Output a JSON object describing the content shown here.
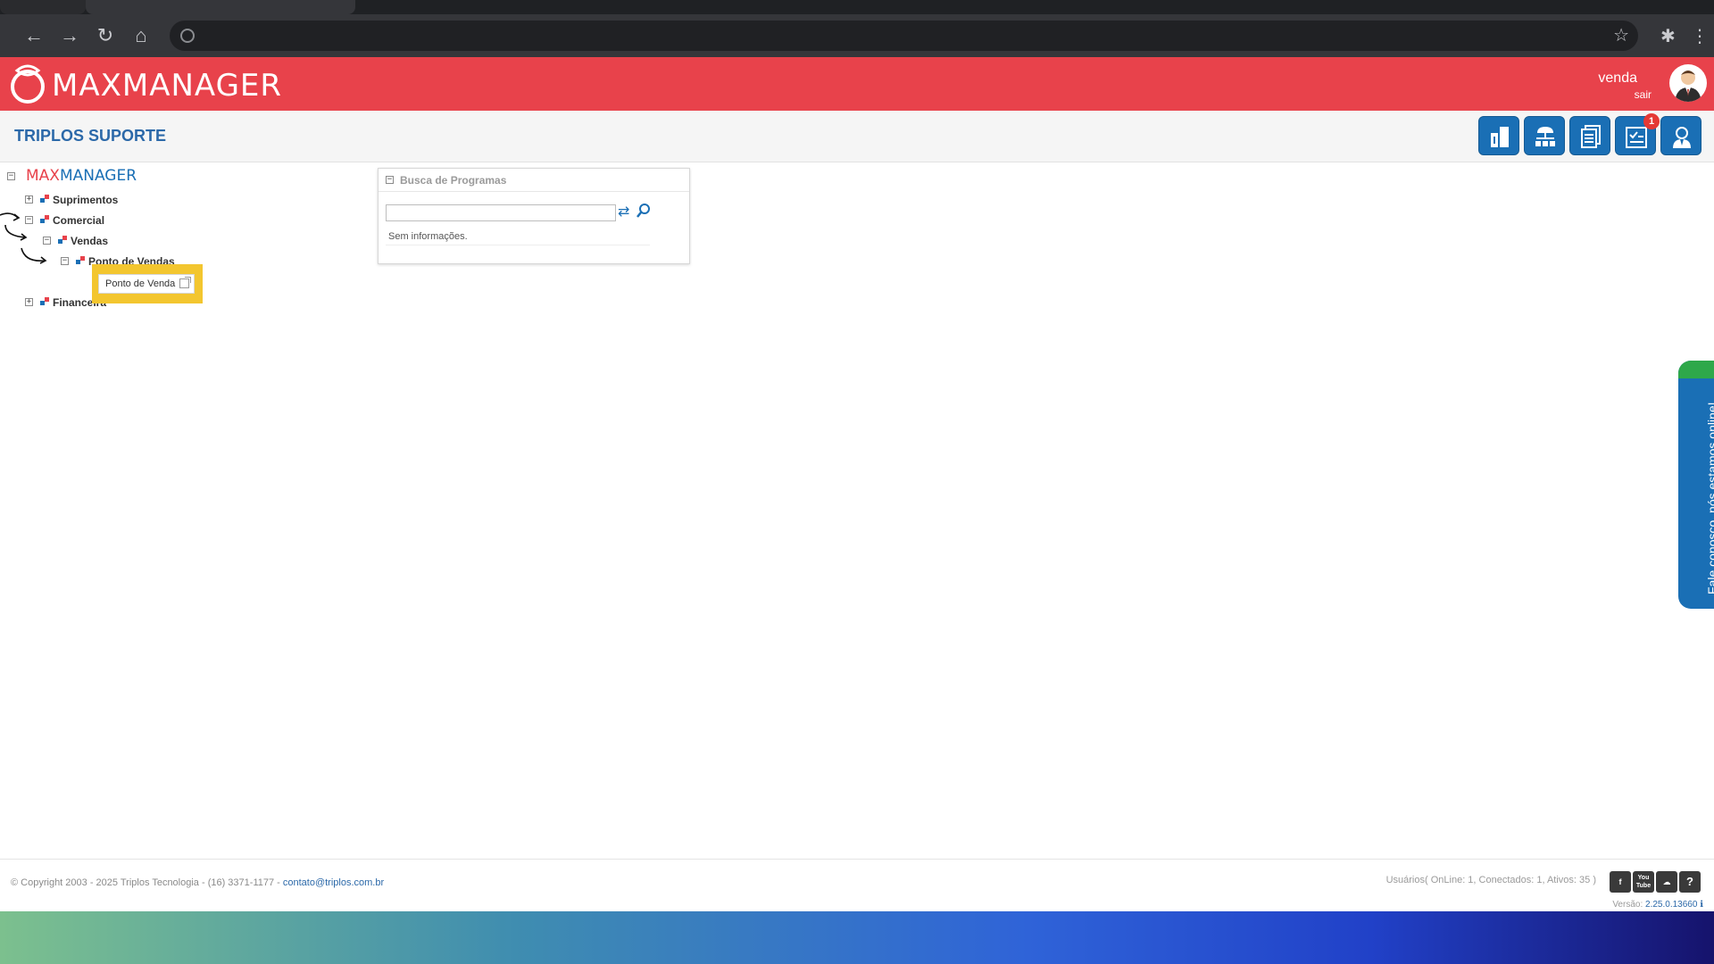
{
  "app": {
    "logo_text": "MAXMANAGER",
    "user_name": "venda",
    "logout_label": "sair",
    "company": "TRIPLOS SUPORTE",
    "notification_count": "1",
    "brand_color": "#e8424b",
    "accent_color": "#1a6fb5"
  },
  "toolbar": {
    "quick_buttons": [
      "reports-icon",
      "network-icon",
      "documents-icon",
      "tasks-icon",
      "support-agent-icon"
    ]
  },
  "tree": {
    "root_left": "MAX",
    "root_right": "MANAGER",
    "items": [
      {
        "label": "Suprimentos",
        "state": "collapsed"
      },
      {
        "label": "Comercial",
        "state": "expanded"
      },
      {
        "label": "Vendas",
        "state": "expanded"
      },
      {
        "label": "Ponto de Vendas",
        "state": "expanded"
      },
      {
        "label": "Financeira",
        "state": "collapsed"
      }
    ],
    "leaf_label": "Ponto de Venda"
  },
  "search": {
    "title": "Busca de Programas",
    "value": "",
    "placeholder": "",
    "empty_text": "Sem informações."
  },
  "chat": {
    "label": "Fale conosco, nós estamos online!"
  },
  "footer": {
    "copyright": "© Copyright 2003 - 2025 Triplos Tecnologia - (16) 3371-1177 - ",
    "email": "contato@triplos.com.br",
    "users": "Usuários( OnLine: 1, Conectados: 1, Ativos: 35 )",
    "social": [
      "facebook-icon",
      "youtube-icon",
      "cloud-icon",
      "help-icon"
    ],
    "youtube_text": "You Tube",
    "version_label": "Versão:",
    "version_number": "2.25.0.13660"
  }
}
